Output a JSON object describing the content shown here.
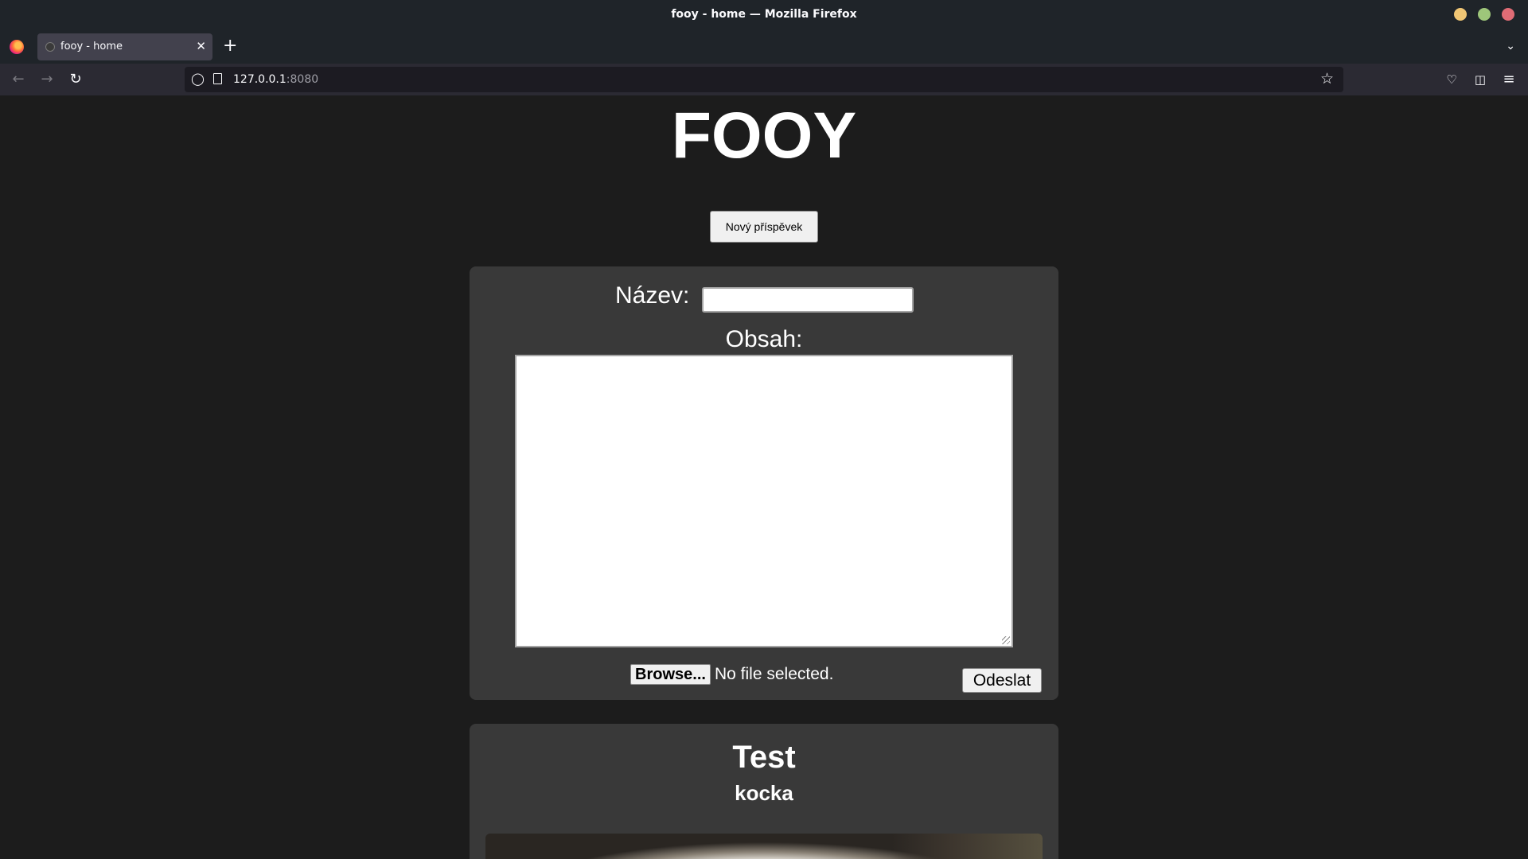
{
  "window": {
    "title": "fooy - home — Mozilla Firefox"
  },
  "browser": {
    "tab_label": "fooy - home",
    "tab_close": "✕",
    "new_tab": "+",
    "url_host": "127.0.0.1",
    "url_port": ":8080"
  },
  "page": {
    "site_title": "FOOY",
    "new_post_button": "Nový příspěvek",
    "form": {
      "name_label": "Název:",
      "name_value": "",
      "content_label": "Obsah:",
      "content_value": "",
      "browse_button": "Browse...",
      "file_status": "No file selected.",
      "submit_button": "Odeslat"
    },
    "posts": [
      {
        "title": "Test",
        "subtitle": "kocka"
      }
    ]
  },
  "icons": {
    "back": "back-arrow-icon",
    "forward": "forward-arrow-icon",
    "reload": "reload-icon",
    "shield": "tracking-shield-icon",
    "page": "page-icon",
    "bookmark": "star-icon",
    "pocket": "pocket-icon",
    "extensions": "extensions-icon",
    "menu": "hamburger-menu-icon"
  }
}
